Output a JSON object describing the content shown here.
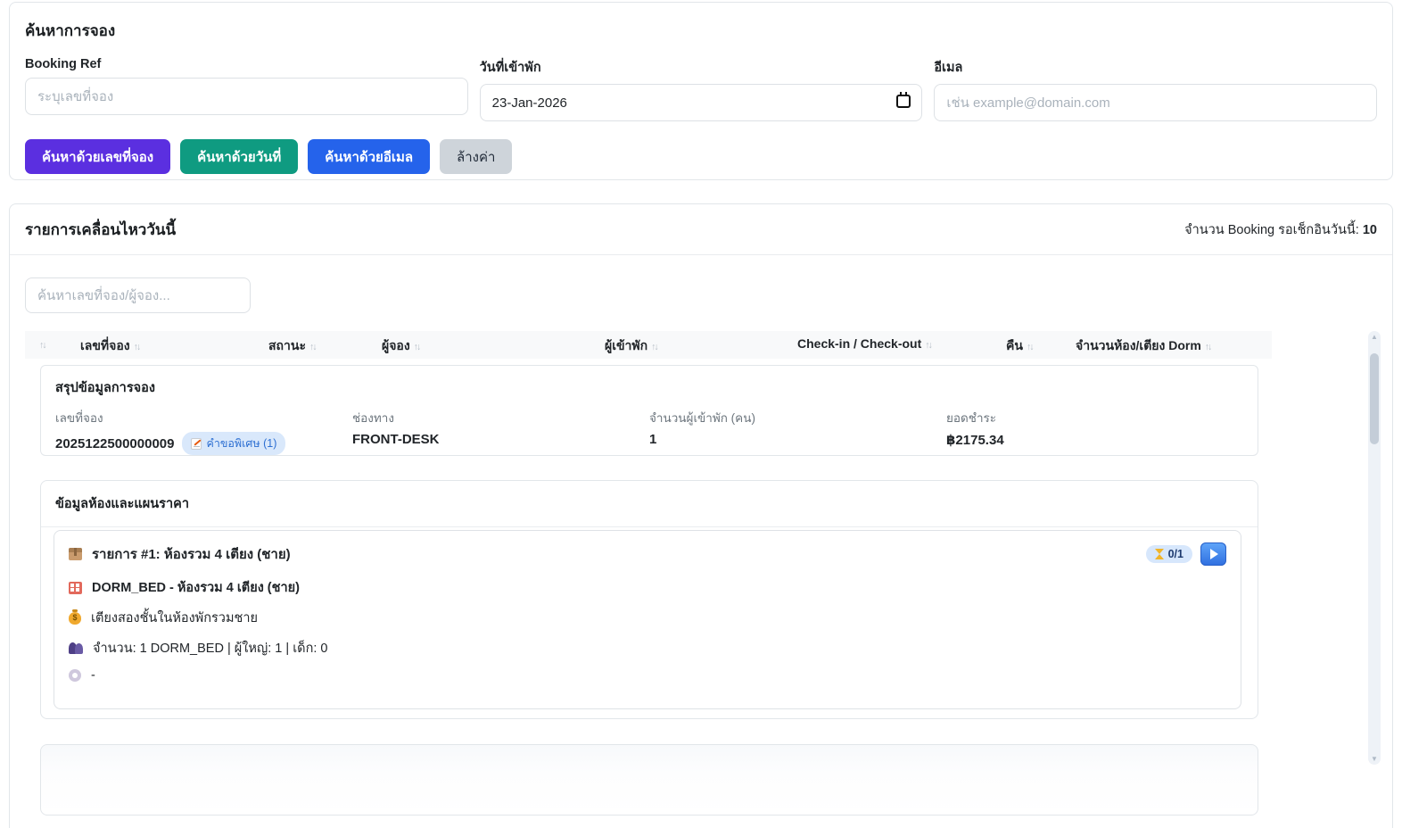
{
  "colors": {
    "btn_search_ref": "#5b2fe0",
    "btn_search_date": "#0f9b81",
    "btn_search_email": "#2563eb",
    "btn_clear_bg": "#ced4da",
    "badge_bg": "#d9e8fb",
    "badge_text": "#2d6fd2",
    "table_head_bg": "#f8f9fa",
    "border": "#e2e6ea"
  },
  "search_section": {
    "title": "ค้นหาการจอง",
    "booking_ref": {
      "label": "Booking Ref",
      "placeholder": "ระบุเลขที่จอง"
    },
    "checkin_date": {
      "label": "วันที่เข้าพัก",
      "value": "23-Jan-2026",
      "icon": "calendar-icon"
    },
    "email": {
      "label": "อีเมล",
      "placeholder": "เช่น example@domain.com"
    },
    "buttons": {
      "search_by_ref": "ค้นหาด้วยเลขที่จอง",
      "search_by_date": "ค้นหาด้วยวันที่",
      "search_by_email": "ค้นหาด้วยอีเมล",
      "clear": "ล้างค่า"
    }
  },
  "movements_section": {
    "title": "รายการเคลื่อนไหววันนี้",
    "pending_checkin_label": "จำนวน Booking รอเช็กอินวันนี้:",
    "pending_checkin_count": "10",
    "search_placeholder": "ค้นหาเลขที่จอง/ผู้จอง...",
    "table": {
      "sort_icon": "↑↓",
      "columns": [
        {
          "label": ""
        },
        {
          "label": "เลขที่จอง"
        },
        {
          "label": "สถานะ"
        },
        {
          "label": "ผู้จอง"
        },
        {
          "label": "ผู้เข้าพัก"
        },
        {
          "label": "Check-in / Check-out"
        },
        {
          "label": "คืน"
        },
        {
          "label": "จำนวนห้อง/เตียง Dorm"
        }
      ]
    }
  },
  "booking_summary": {
    "title": "สรุปข้อมูลการจอง",
    "booking_no": {
      "label": "เลขที่จอง",
      "value": "2025122500000009"
    },
    "channel": {
      "label": "ช่องทาง",
      "value": "FRONT-DESK"
    },
    "guests": {
      "label": "จำนวนผู้เข้าพัก (คน)",
      "value": "1"
    },
    "paid": {
      "label": "ยอดชำระ",
      "value": "฿2175.34"
    },
    "special_request_badge": {
      "icon": "memo-icon",
      "label": "คำขอพิเศษ (1)"
    }
  },
  "room_section": {
    "title": "ข้อมูลห้องและแผนราคา",
    "item": {
      "title_icon": "package-icon",
      "title": "รายการ #1: ห้องรวม 4 เตียง (ชาย)",
      "room_type_icon": "hotel-icon",
      "room_type": "DORM_BED - ห้องรวม 4 เตียง (ชาย)",
      "rate_plan_icon": "money-bag-icon",
      "rate_plan": "เตียงสองชั้นในห้องพักรวมชาย",
      "occupancy_icon": "people-icon",
      "occupancy": "จำนวน: 1 DORM_BED | ผู้ใหญ่: 1 | เด็ก: 0",
      "meal_icon": "meal-plate-icon",
      "meal": "-",
      "progress_badge": {
        "icon": "hourglass-icon",
        "label": "0/1"
      },
      "play_button": "play-icon"
    }
  }
}
